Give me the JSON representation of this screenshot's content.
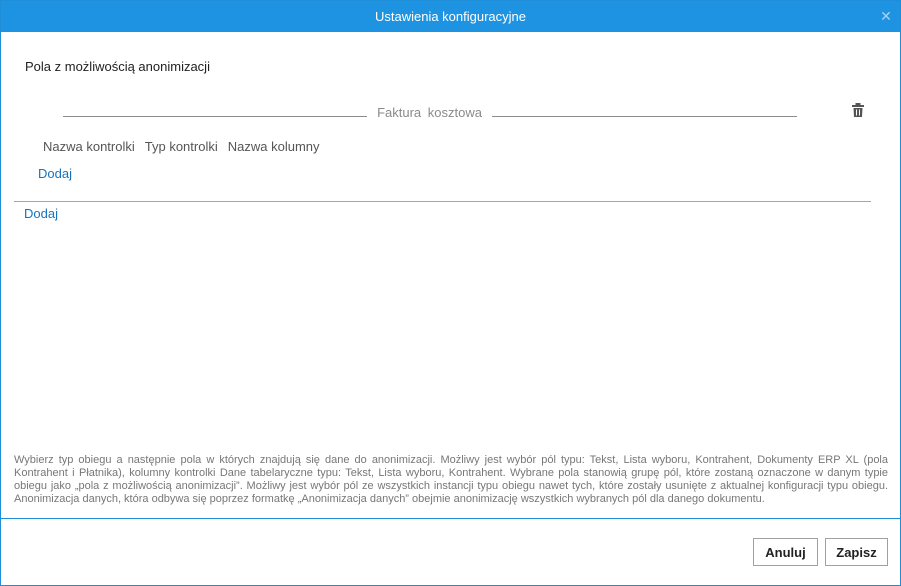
{
  "window": {
    "title": "Ustawienia konfiguracyjne",
    "close_glyph": "✕"
  },
  "section": {
    "heading": "Pola z możliwością anonimizacji"
  },
  "group": {
    "name": "Faktura  kosztowa",
    "delete_icon": "trash-icon",
    "columns": [
      "Nazwa kontrolki",
      "Typ kontrolki",
      "Nazwa kolumny"
    ],
    "add_label": "Dodaj"
  },
  "add_group_label": "Dodaj",
  "description": "Wybierz typ obiegu a następnie pola w których znajdują się dane do anonimizacji. Możliwy jest wybór pól typu: Tekst, Lista wyboru, Kontrahent, Dokumenty ERP XL (pola Kontrahent i Płatnika), kolumny kontrolki Dane tabelaryczne typu: Tekst, Lista wyboru, Kontrahent. Wybrane pola stanowią grupę pól, które zostaną oznaczone w danym typie obiegu jako „pola z możliwością anonimizacji”. Możliwy jest wybór pól ze wszystkich instancji typu obiegu nawet tych, które zostały usunięte z aktualnej konfiguracji typu obiegu. Anonimizacja danych, która odbywa się poprzez formatkę „Anonimizacja danych” obejmie anonimizację wszystkich wybranych pól dla danego dokumentu.",
  "buttons": {
    "cancel_label": "Anuluj",
    "save_label": "Zapisz"
  },
  "colors": {
    "titlebar": "#1e93e2",
    "link": "#1573c0"
  }
}
